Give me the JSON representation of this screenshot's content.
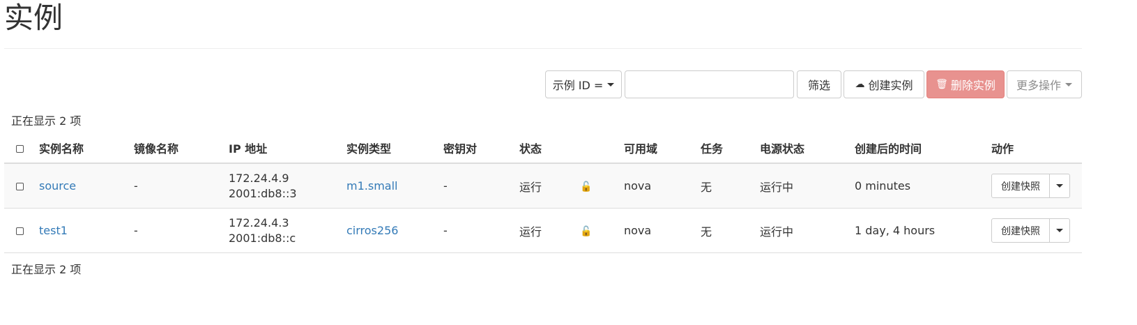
{
  "page": {
    "title": "实例"
  },
  "toolbar": {
    "filter_select_label": "示例 ID =",
    "filter_input_value": "",
    "filter_button_label": "筛选",
    "create_button_label": "创建实例",
    "delete_button_label": "删除实例",
    "more_button_label": "更多操作",
    "colors": {
      "delete_bg": "#e8928f",
      "link": "#337ab7"
    }
  },
  "count_text": "正在显示 2 项",
  "table": {
    "headers": {
      "name": "实例名称",
      "image": "镜像名称",
      "ip": "IP 地址",
      "flavor": "实例类型",
      "keypair": "密钥对",
      "status": "状态",
      "az": "可用域",
      "task": "任务",
      "power": "电源状态",
      "age": "创建后的时间",
      "actions": "动作"
    },
    "rows": [
      {
        "name": "source",
        "image": "-",
        "ip1": "172.24.4.9",
        "ip2": "2001:db8::3",
        "flavor": "m1.small",
        "keypair": "-",
        "status": "运行",
        "lock_icon": "unlock-icon",
        "az": "nova",
        "task": "无",
        "power": "运行中",
        "age": "0 minutes",
        "action_label": "创建快照"
      },
      {
        "name": "test1",
        "image": "-",
        "ip1": "172.24.4.3",
        "ip2": "2001:db8::c",
        "flavor": "cirros256",
        "keypair": "-",
        "status": "运行",
        "lock_icon": "unlock-icon",
        "az": "nova",
        "task": "无",
        "power": "运行中",
        "age": "1 day, 4 hours",
        "action_label": "创建快照"
      }
    ]
  }
}
